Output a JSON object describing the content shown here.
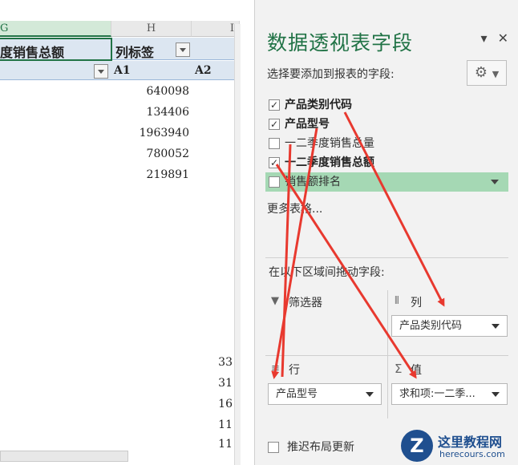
{
  "sheet": {
    "columns": [
      "G",
      "H",
      "I"
    ],
    "pivot_header_left": "度销售总额",
    "column_labels": "列标签",
    "sub_headers": [
      "A1",
      "A2"
    ],
    "values": [
      "640098",
      "134406",
      "1963940",
      "780052",
      "219891"
    ],
    "right_edge_values": [
      "33",
      "31",
      "16",
      "11",
      "11"
    ]
  },
  "panel": {
    "title": "数据透视表字段",
    "choose_label": "选择要添加到报表的字段:",
    "fields": [
      {
        "label": "产品类别代码",
        "checked": true,
        "bold": true
      },
      {
        "label": "产品型号",
        "checked": true,
        "bold": true
      },
      {
        "label": "一二季度销售总量",
        "checked": false,
        "bold": false
      },
      {
        "label": "一二季度销售总额",
        "checked": true,
        "bold": true
      },
      {
        "label": "销售额排名",
        "checked": false,
        "bold": false
      }
    ],
    "more_tables": "更多表格...",
    "drag_label": "在以下区域间拖动字段:",
    "areas": {
      "filter": {
        "title": "筛选器",
        "icon": "▼"
      },
      "columns": {
        "title": "列",
        "icon": "⦀",
        "value": "产品类别代码"
      },
      "rows": {
        "title": "行",
        "icon": "≡",
        "value": "产品型号"
      },
      "values": {
        "title": "值",
        "icon": "Σ",
        "value": "求和项:一二季..."
      }
    },
    "defer_label": "推迟布局更新"
  },
  "watermark": {
    "logo": "Z",
    "text": "这里教程网",
    "url": "herecours.com"
  },
  "colors": {
    "accent": "#217346",
    "highlight": "#a5d8b4",
    "arrow": "#e8392f"
  }
}
